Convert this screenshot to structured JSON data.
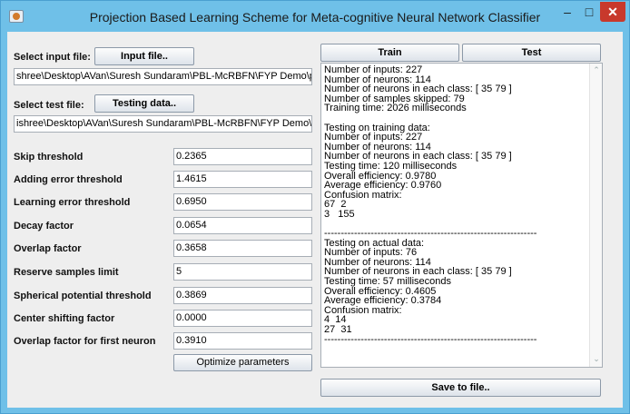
{
  "window": {
    "title": "Projection Based Learning Scheme for Meta-cognitive Neural Network Classifier",
    "minimize_glyph": "–",
    "maximize_glyph": "□",
    "close_glyph": "✕"
  },
  "input": {
    "select_label": "Select input file:",
    "button_label": "Input file..",
    "path": "shree\\Desktop\\AVan\\Suresh Sundaram\\PBL-McRBFN\\FYP Demo\\p_train.txt"
  },
  "test": {
    "select_label": "Select test file:",
    "button_label": "Testing data..",
    "path": "ishree\\Desktop\\AVan\\Suresh Sundaram\\PBL-McRBFN\\FYP Demo\\p_test.txt"
  },
  "params": [
    {
      "label": "Skip threshold",
      "value": "0.2365"
    },
    {
      "label": "Adding error threshold",
      "value": "1.4615"
    },
    {
      "label": "Learning error threshold",
      "value": "0.6950"
    },
    {
      "label": "Decay factor",
      "value": "0.0654"
    },
    {
      "label": "Overlap factor",
      "value": "0.3658"
    },
    {
      "label": "Reserve samples limit",
      "value": "5"
    },
    {
      "label": "Spherical potential threshold",
      "value": "0.3869"
    },
    {
      "label": "Center shifting factor",
      "value": "0.0000"
    },
    {
      "label": "Overlap factor for first neuron",
      "value": "0.3910"
    }
  ],
  "optimize_label": "Optimize parameters",
  "train_label": "Train",
  "test_label": "Test",
  "save_label": "Save to file..",
  "output_text": "Number of inputs: 227\nNumber of neurons: 114\nNumber of neurons in each class: [ 35 79 ]\nNumber of samples skipped: 79\nTraining time: 2026 milliseconds\n\nTesting on training data:\nNumber of inputs: 227\nNumber of neurons: 114\nNumber of neurons in each class: [ 35 79 ]\nTesting time: 120 milliseconds\nOverall efficiency: 0.9780\nAverage efficiency: 0.9760\nConfusion matrix:\n67  2\n3   155\n\n----------------------------------------------------------------\nTesting on actual data:\nNumber of inputs: 76\nNumber of neurons: 114\nNumber of neurons in each class: [ 35 79 ]\nTesting time: 57 milliseconds\nOverall efficiency: 0.4605\nAverage efficiency: 0.3784\nConfusion matrix:\n4  14\n27  31\n----------------------------------------------------------------"
}
